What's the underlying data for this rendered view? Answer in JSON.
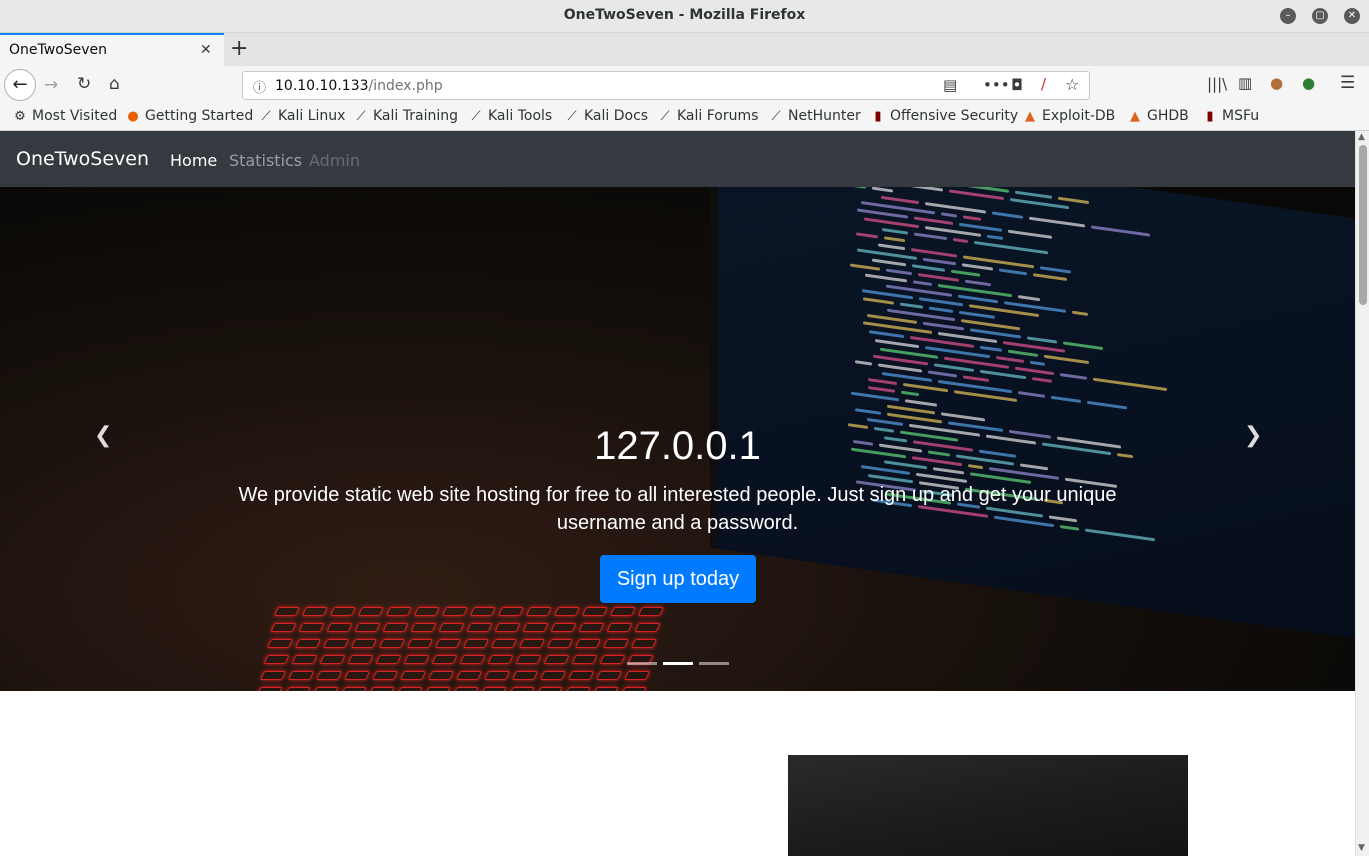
{
  "window": {
    "title": "OneTwoSeven - Mozilla Firefox"
  },
  "tabs": [
    {
      "label": "OneTwoSeven"
    }
  ],
  "urlbar": {
    "host": "10.10.10.133",
    "path": "/index.php"
  },
  "bookmarks": [
    {
      "label": "Most Visited",
      "icon": "gear-icon"
    },
    {
      "label": "Getting Started",
      "icon": "firefox-icon"
    },
    {
      "label": "Kali Linux",
      "icon": "kali-icon"
    },
    {
      "label": "Kali Training",
      "icon": "kali-icon"
    },
    {
      "label": "Kali Tools",
      "icon": "kali-icon"
    },
    {
      "label": "Kali Docs",
      "icon": "kali-icon"
    },
    {
      "label": "Kali Forums",
      "icon": "kali-icon"
    },
    {
      "label": "NetHunter",
      "icon": "kali-icon"
    },
    {
      "label": "Offensive Security",
      "icon": "offsec-icon"
    },
    {
      "label": "Exploit-DB",
      "icon": "exploitdb-icon"
    },
    {
      "label": "GHDB",
      "icon": "exploitdb-icon"
    },
    {
      "label": "MSFu",
      "icon": "offsec-icon"
    }
  ],
  "site": {
    "brand": "OneTwoSeven",
    "nav": [
      {
        "label": "Home",
        "state": "active"
      },
      {
        "label": "Statistics",
        "state": "normal"
      },
      {
        "label": "Admin",
        "state": "disabled"
      }
    ]
  },
  "hero": {
    "title": "127.0.0.1",
    "text": "We provide static web site hosting for free to all interested people. Just sign up and get your unique username and a password.",
    "button": "Sign up today",
    "active_slide": 2,
    "slide_count": 3
  },
  "colors": {
    "navbar_bg": "#343a40",
    "primary": "#007bff",
    "tab_accent": "#0a84ff"
  }
}
